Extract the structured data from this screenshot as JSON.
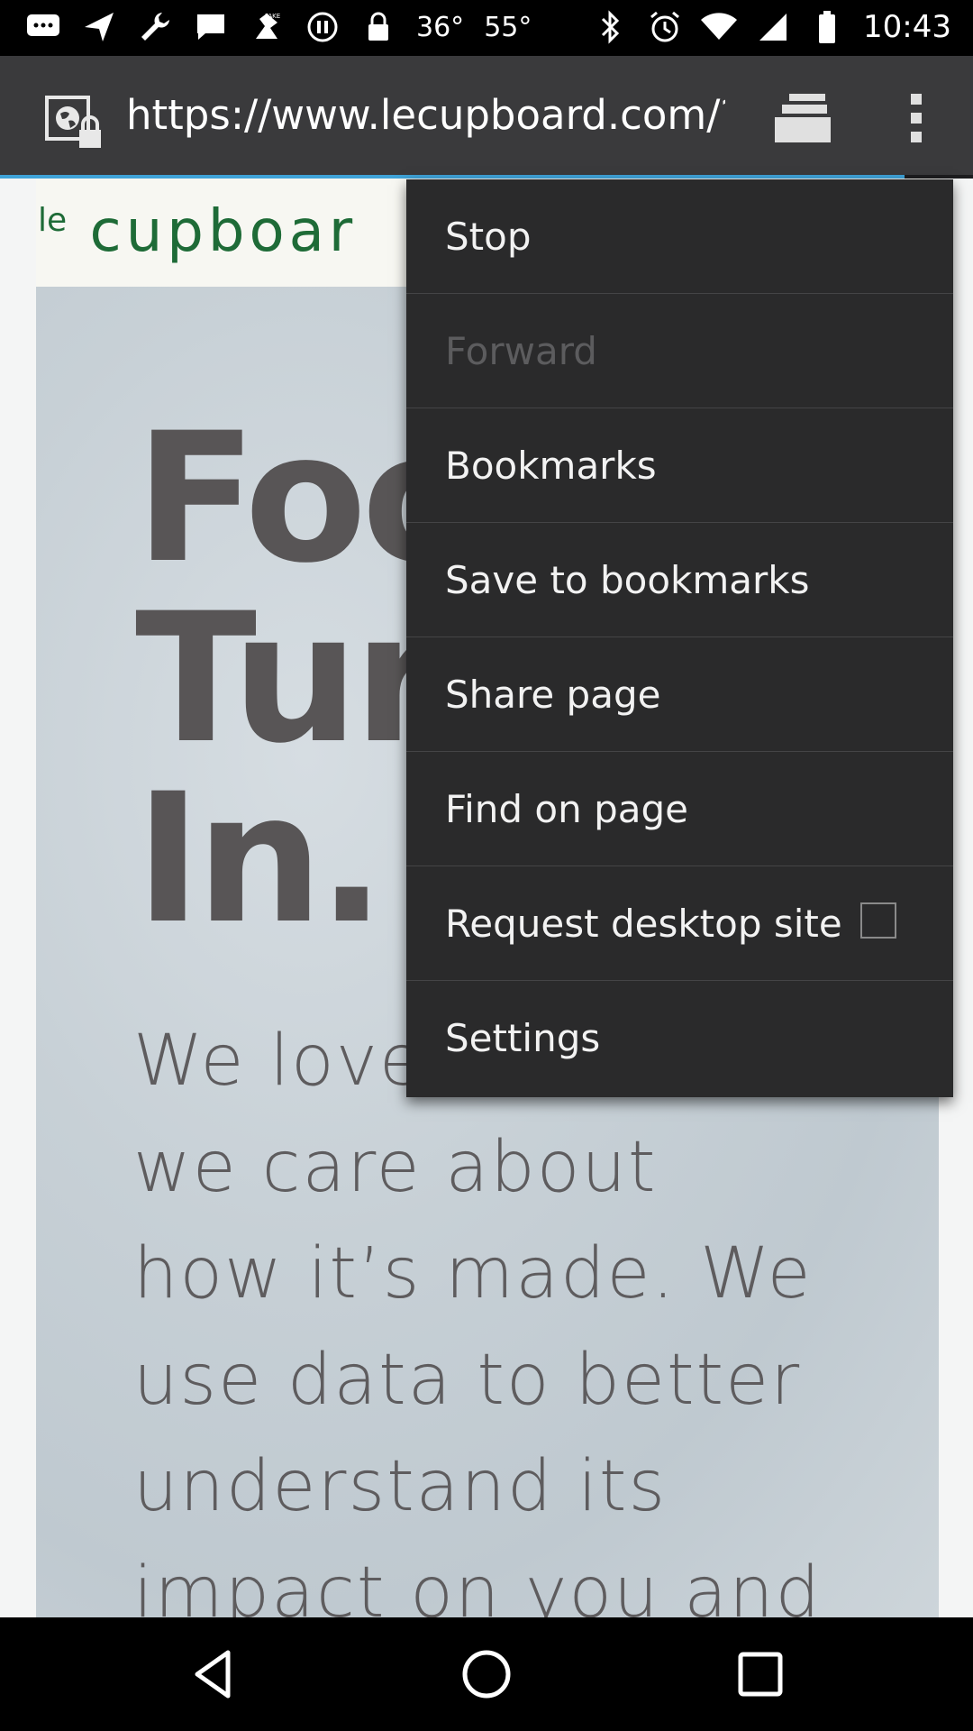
{
  "status_bar": {
    "icons_left": [
      "messages-icon",
      "send-icon",
      "wrench-icon",
      "chat-icon",
      "fake-gps-icon",
      "pause-circle-icon",
      "lock-icon"
    ],
    "temp1": "36°",
    "temp2": "55°",
    "icons_right": [
      "bluetooth-icon",
      "alarm-icon",
      "wifi-icon",
      "signal-icon",
      "battery-icon"
    ],
    "time": "10:43"
  },
  "browser": {
    "url": "https://www.lecupboard.com/?g",
    "page_load_progress": 0.93
  },
  "page": {
    "logo_prefix": "le",
    "logo_text": "cupboar",
    "hero_lines": [
      "Foo",
      "Tur",
      "In."
    ],
    "body_lines": [
      "We love",
      "we care about",
      "how it’s made. We",
      "use data to better",
      "understand its",
      "impact on you and"
    ]
  },
  "menu": {
    "items": [
      {
        "label": "Stop",
        "enabled": true
      },
      {
        "label": "Forward",
        "enabled": false
      },
      {
        "label": "Bookmarks",
        "enabled": true
      },
      {
        "label": "Save to bookmarks",
        "enabled": true
      },
      {
        "label": "Share page",
        "enabled": true
      },
      {
        "label": "Find on page",
        "enabled": true
      },
      {
        "label": "Request desktop site",
        "enabled": true,
        "checked": false
      },
      {
        "label": "Settings",
        "enabled": true
      }
    ]
  },
  "colors": {
    "toolbar": "#3a3a3c",
    "menu_bg": "#2a2a2b",
    "progress": "#3fa3d8",
    "logo_green": "#1e6b37"
  },
  "nav_bar": {
    "buttons": [
      "back-icon",
      "home-icon",
      "recents-icon"
    ]
  }
}
